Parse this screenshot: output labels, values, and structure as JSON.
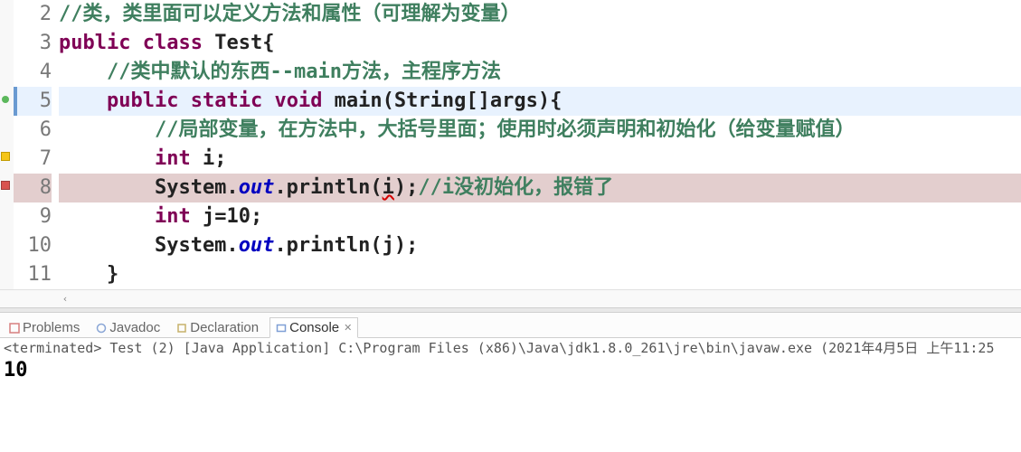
{
  "editor": {
    "lines": [
      {
        "n": 2,
        "marker": null,
        "blue": false,
        "cls": ""
      },
      {
        "n": 3,
        "marker": null,
        "blue": false,
        "cls": ""
      },
      {
        "n": 4,
        "marker": null,
        "blue": false,
        "cls": ""
      },
      {
        "n": 5,
        "marker": "green",
        "blue": true,
        "cls": "line-hl"
      },
      {
        "n": 6,
        "marker": null,
        "blue": false,
        "cls": ""
      },
      {
        "n": 7,
        "marker": "warn",
        "blue": false,
        "cls": ""
      },
      {
        "n": 8,
        "marker": "err",
        "blue": false,
        "cls": "line-err-bg"
      },
      {
        "n": 9,
        "marker": null,
        "blue": false,
        "cls": ""
      },
      {
        "n": 10,
        "marker": null,
        "blue": false,
        "cls": ""
      },
      {
        "n": 11,
        "marker": null,
        "blue": false,
        "cls": ""
      }
    ],
    "tokens": {
      "2": [
        {
          "t": "//类，类里面可以定义方法和属性（可理解为变量）",
          "c": "comment"
        }
      ],
      "3": [
        {
          "t": "public",
          "c": "kw"
        },
        {
          "t": " ",
          "c": "normal"
        },
        {
          "t": "class",
          "c": "kw"
        },
        {
          "t": " Test{",
          "c": "normal"
        }
      ],
      "4": [
        {
          "t": "    ",
          "c": "normal"
        },
        {
          "t": "//类中默认的东西--main方法，主程序方法",
          "c": "comment"
        }
      ],
      "5": [
        {
          "t": "    ",
          "c": "normal"
        },
        {
          "t": "public",
          "c": "kw"
        },
        {
          "t": " ",
          "c": "normal"
        },
        {
          "t": "static",
          "c": "kw"
        },
        {
          "t": " ",
          "c": "normal"
        },
        {
          "t": "void",
          "c": "kw"
        },
        {
          "t": " main(String[]args){",
          "c": "normal"
        }
      ],
      "6": [
        {
          "t": "        ",
          "c": "normal"
        },
        {
          "t": "//局部变量，在方法中，大括号里面；使用时必须声明和初始化（给变量赋值）",
          "c": "comment"
        }
      ],
      "7": [
        {
          "t": "        ",
          "c": "normal"
        },
        {
          "t": "int",
          "c": "kw"
        },
        {
          "t": " i;",
          "c": "normal"
        }
      ],
      "8": [
        {
          "t": "        System.",
          "c": "normal"
        },
        {
          "t": "out",
          "c": "static-field"
        },
        {
          "t": ".println(",
          "c": "normal"
        },
        {
          "t": "i",
          "c": "normal err-underline"
        },
        {
          "t": ");",
          "c": "normal"
        },
        {
          "t": "//i没初始化，报错了",
          "c": "comment"
        }
      ],
      "9": [
        {
          "t": "        ",
          "c": "normal"
        },
        {
          "t": "int",
          "c": "kw"
        },
        {
          "t": " j=10;",
          "c": "normal"
        }
      ],
      "10": [
        {
          "t": "        System.",
          "c": "normal"
        },
        {
          "t": "out",
          "c": "static-field"
        },
        {
          "t": ".println(j);",
          "c": "normal"
        }
      ],
      "11": [
        {
          "t": "    }",
          "c": "normal"
        }
      ]
    }
  },
  "tabs": {
    "problems": {
      "label": "Problems",
      "icon_color": "#d77f7f"
    },
    "javadoc": {
      "label": "Javadoc",
      "icon_color": "#8aa6d6"
    },
    "declaration": {
      "label": "Declaration",
      "icon_color": "#c7b26b"
    },
    "console": {
      "label": "Console",
      "icon_color": "#7f9fd6"
    }
  },
  "console": {
    "header": "<terminated> Test (2) [Java Application] C:\\Program Files (x86)\\Java\\jdk1.8.0_261\\jre\\bin\\javaw.exe (2021年4月5日 上午11:25",
    "output": "10"
  }
}
